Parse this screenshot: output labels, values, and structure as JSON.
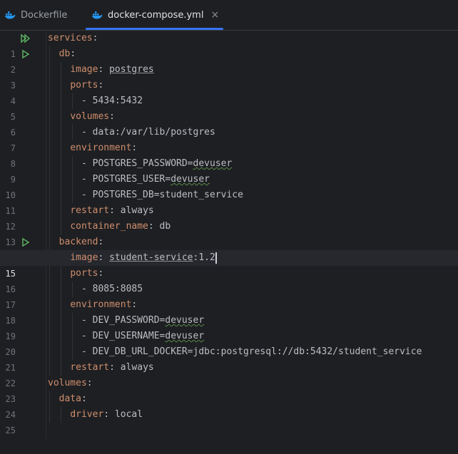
{
  "tabs": [
    {
      "label": "Dockerfile",
      "icon": "docker-icon",
      "active": false
    },
    {
      "label": "docker-compose.yml",
      "icon": "docker-icon",
      "active": true,
      "close": "×"
    }
  ],
  "colors": {
    "key": "#cf8e6d",
    "value": "#bcbec4",
    "accent": "#3574f0",
    "run": "#5fb865"
  },
  "lines": [
    {
      "n": "1",
      "run": "double"
    },
    {
      "n": "2",
      "run": "single"
    },
    {
      "n": "3"
    },
    {
      "n": "4"
    },
    {
      "n": "5"
    },
    {
      "n": "6"
    },
    {
      "n": "7"
    },
    {
      "n": "8"
    },
    {
      "n": "9"
    },
    {
      "n": "10"
    },
    {
      "n": "11"
    },
    {
      "n": "12"
    },
    {
      "n": "13"
    },
    {
      "n": "14",
      "run": "single"
    },
    {
      "n": "15",
      "current": true
    },
    {
      "n": "16"
    },
    {
      "n": "17"
    },
    {
      "n": "18"
    },
    {
      "n": "19"
    },
    {
      "n": "20"
    },
    {
      "n": "21"
    },
    {
      "n": "22"
    },
    {
      "n": "23"
    },
    {
      "n": "24"
    },
    {
      "n": "25"
    }
  ],
  "code": {
    "l1": "services",
    "l2": "db",
    "l3k": "image",
    "l3v": "postgres",
    "l4": "ports",
    "l5": "- 5434:5432",
    "l6": "volumes",
    "l7": "- data:/var/lib/postgres",
    "l8": "environment",
    "l9a": "- POSTGRES_PASSWORD=",
    "l9b": "devuser",
    "l10a": "- POSTGRES_USER=",
    "l10b": "devuser",
    "l11": "- POSTGRES_DB=student_service",
    "l12k": "restart",
    "l12v": "always",
    "l13k": "container_name",
    "l13v": "db",
    "l14": "backend",
    "l15k": "image",
    "l15v1": "student-service",
    "l15v2": ":1.2",
    "l16": "ports",
    "l17": "- 8085:8085",
    "l18": "environment",
    "l19a": "- DEV_PASSWORD=",
    "l19b": "devuser",
    "l20a": "- DEV_USERNAME=",
    "l20b": "devuser",
    "l21": "- DEV_DB_URL_DOCKER=jdbc:postgresql://db:5432/student_service",
    "l22k": "restart",
    "l22v": "always",
    "l23": "volumes",
    "l24": "data",
    "l25k": "driver",
    "l25v": "local"
  }
}
